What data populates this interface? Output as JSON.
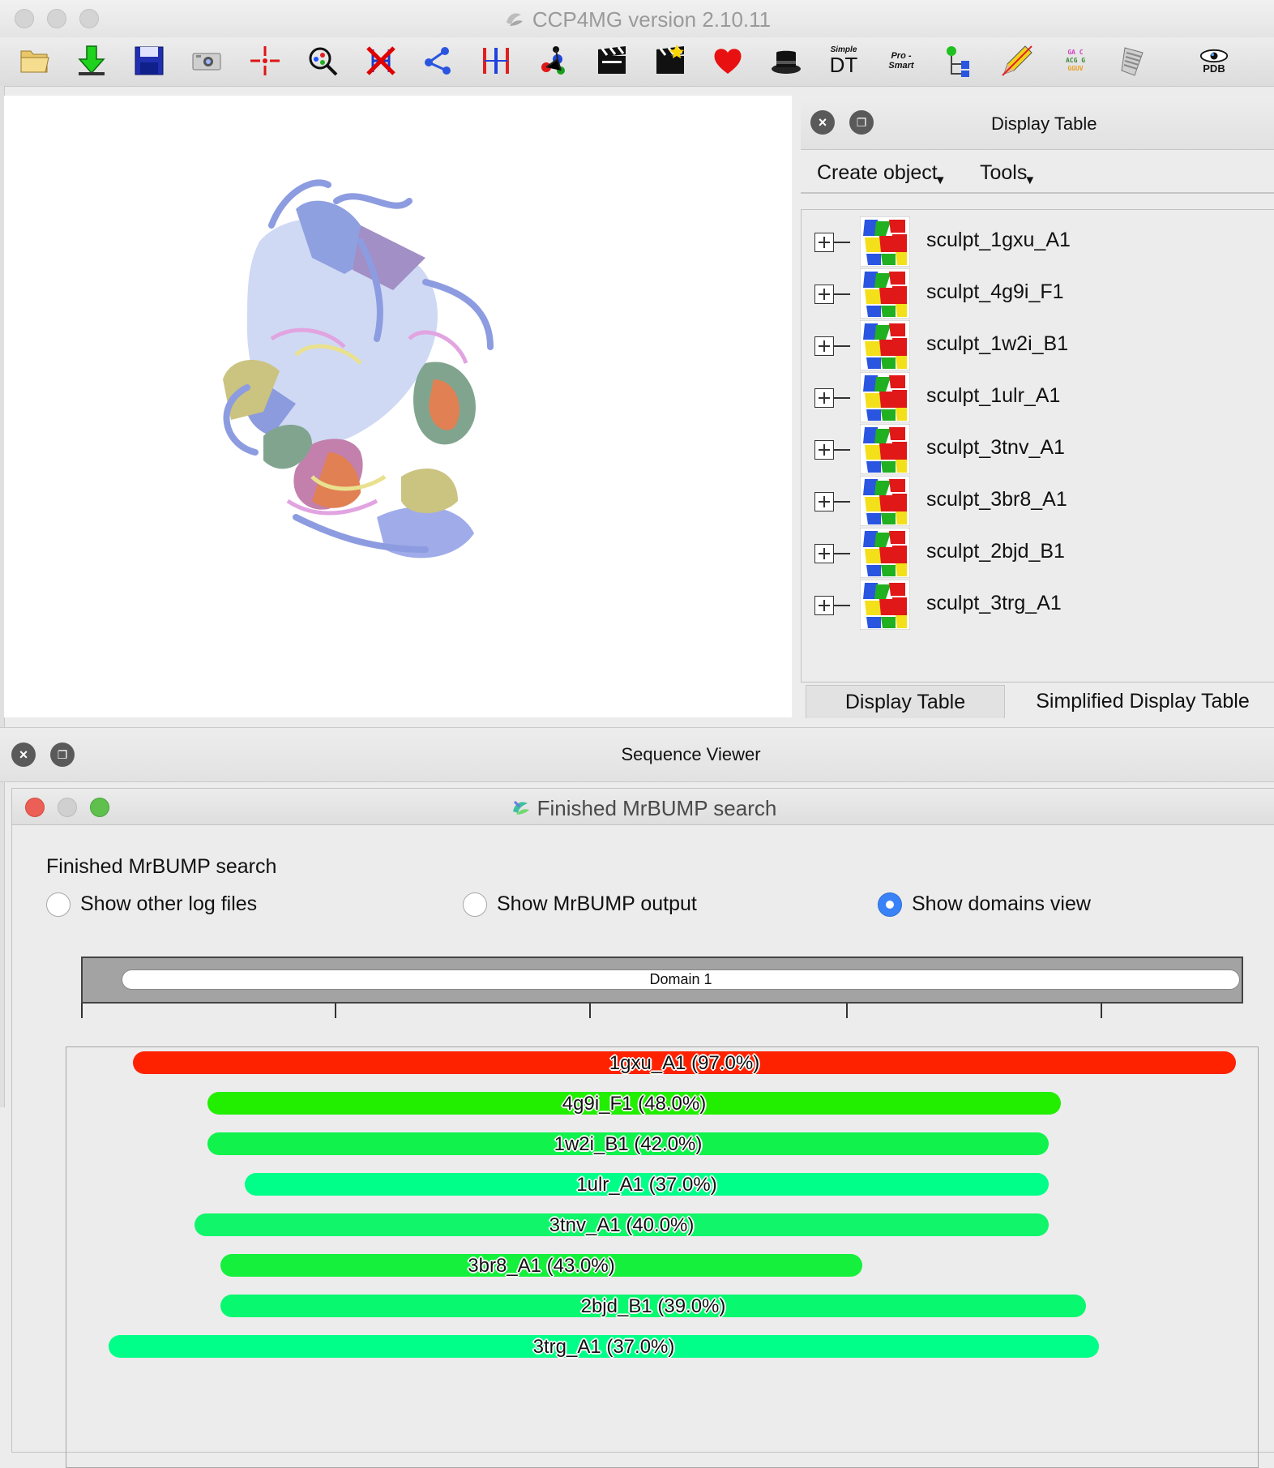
{
  "window": {
    "title": "CCP4MG version 2.10.11"
  },
  "toolbar": {
    "icons": [
      "open-file-icon",
      "download-icon",
      "save-icon",
      "camera-icon",
      "centre-icon",
      "zoom-search-icon",
      "clear-labels-icon",
      "connect-icon",
      "distance-icon",
      "molecule-icon",
      "movie-icon",
      "clapper-icon",
      "heart-icon",
      "magic-hat-icon",
      "simple-dt-icon",
      "pro-smart-icon",
      "tree-icon",
      "pencil-icon",
      "sequence-icon",
      "spiral-notebook-icon",
      "pdb-eye-icon"
    ],
    "simple_dt_small": "Simple",
    "simple_dt_big": "DT",
    "pro_smart_1": "Pro -",
    "pro_smart_2": "Smart",
    "pdb_label": "PDB",
    "seq_1": "GA  C",
    "seq_2": "ACG G",
    "seq_3": "GGUV"
  },
  "display_table": {
    "title": "Display Table",
    "menus": {
      "create": "Create object",
      "tools": "Tools"
    },
    "objects": [
      {
        "name": "sculpt_1gxu_A1"
      },
      {
        "name": "sculpt_4g9i_F1"
      },
      {
        "name": "sculpt_1w2i_B1"
      },
      {
        "name": "sculpt_1ulr_A1"
      },
      {
        "name": "sculpt_3tnv_A1"
      },
      {
        "name": "sculpt_3br8_A1"
      },
      {
        "name": "sculpt_2bjd_B1"
      },
      {
        "name": "sculpt_3trg_A1"
      }
    ],
    "tabs": {
      "display": "Display Table",
      "simplified": "Simplified Display Table"
    }
  },
  "sequence_viewer": {
    "title": "Sequence Viewer"
  },
  "dialog": {
    "title": "Finished MrBUMP search",
    "heading": "Finished MrBUMP search",
    "options": [
      {
        "label": "Show other log files",
        "selected": false
      },
      {
        "label": "Show MrBUMP output",
        "selected": false
      },
      {
        "label": "Show domains view",
        "selected": true
      }
    ],
    "domain_label": "Domain 1",
    "hits": [
      {
        "label": "1gxu_A1 (97.0%)",
        "color": "#ff2200"
      },
      {
        "label": "4g9i_F1 (48.0%)",
        "color": "#22ee00"
      },
      {
        "label": "1w2i_B1 (42.0%)",
        "color": "#11f24d"
      },
      {
        "label": "1ulr_A1 (37.0%)",
        "color": "#00ff88"
      },
      {
        "label": "3tnv_A1 (40.0%)",
        "color": "#10f56a"
      },
      {
        "label": "3br8_A1 (43.0%)",
        "color": "#14f03c"
      },
      {
        "label": "2bjd_B1 (39.0%)",
        "color": "#08f870"
      },
      {
        "label": "3trg_A1 (37.0%)",
        "color": "#00ff88"
      }
    ]
  },
  "colors": {
    "accent_radio": "#3a82f7",
    "close_red": "#ec5f57",
    "min_gray": "#d0d0d0",
    "zoom_green": "#5fc04e"
  }
}
